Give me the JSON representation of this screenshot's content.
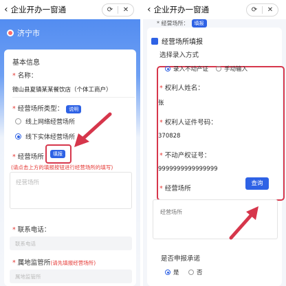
{
  "left": {
    "header": {
      "back_icon": "back-arrow-icon",
      "title": "企业开办一窗通",
      "capsule_refresh_icon": "refresh-icon",
      "capsule_close_icon": "close-icon"
    },
    "city": "济宁市",
    "section_title": "基本信息",
    "name_label": "名称：",
    "name_value": "微山县夏镇某某餐饮店（个体工商户）",
    "place_type_label": "经营场所类型：",
    "place_type_tag": "说明",
    "place_type_options": [
      "线上网络经营场所",
      "线下实体经营场所"
    ],
    "place_label": "经营场所",
    "place_tag": "填报",
    "place_hint": "(请点击上方的填报按钮进行经营场所的填写)",
    "place_placeholder": "经营场所",
    "phone_label": "联系电话：",
    "phone_placeholder": "联系电话",
    "authority_label": "属地监管所",
    "authority_hint": "(请先填报经营场所)",
    "authority_placeholder": "属地监管所",
    "required_mark": "*"
  },
  "right": {
    "header": {
      "back_icon": "back-arrow-icon",
      "title": "企业开办一窗通",
      "capsule_refresh_icon": "refresh-icon",
      "capsule_close_icon": "close-icon"
    },
    "banner_label": "* 经营场所：",
    "banner_tag": "填报",
    "section_title": "经营场所填报",
    "mode_label": "选择录入方式",
    "mode_options": [
      "录入不动产证",
      "手动输入"
    ],
    "owner_label": "权利人姓名：",
    "owner_value": "张",
    "idno_label": "权利人证件号码：",
    "idno_value": "370828",
    "cert_label": "不动产权证号：",
    "cert_value": "9999999999999999",
    "place_label": "经营场所",
    "query_button": "查询",
    "place_placeholder": "经营场所",
    "commit_label": "是否申报承诺",
    "commit_options": [
      "是",
      "否"
    ],
    "required_mark": "*"
  },
  "colors": {
    "primary": "#2e62e5",
    "required": "#e53935",
    "annotation": "#d6364b"
  }
}
